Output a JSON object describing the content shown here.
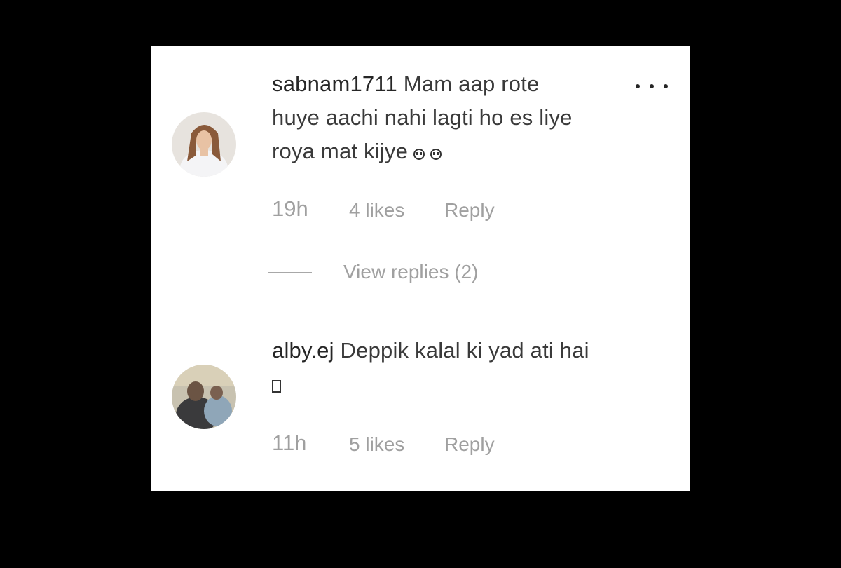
{
  "comments": [
    {
      "username": "sabnam1711",
      "text_line1": "Mam aap rote",
      "text_line2": "huye aachi nahi lagti ho es liye",
      "text_line3": "roya mat kijye",
      "emoji_icons": [
        "crying-face-icon",
        "crying-face-icon"
      ],
      "time": "19h",
      "likes": "4 likes",
      "reply_label": "Reply",
      "view_replies": "View replies (2)"
    },
    {
      "username": "alby.ej",
      "text_line1": "Deppik kalal ki yad ati hai",
      "trailing_icon": "missing-glyph-icon",
      "time": "11h",
      "likes": "5 likes",
      "reply_label": "Reply"
    }
  ],
  "colors": {
    "background": "#000000",
    "card": "#ffffff",
    "text": "#262626",
    "secondary": "#a0a0a0"
  }
}
